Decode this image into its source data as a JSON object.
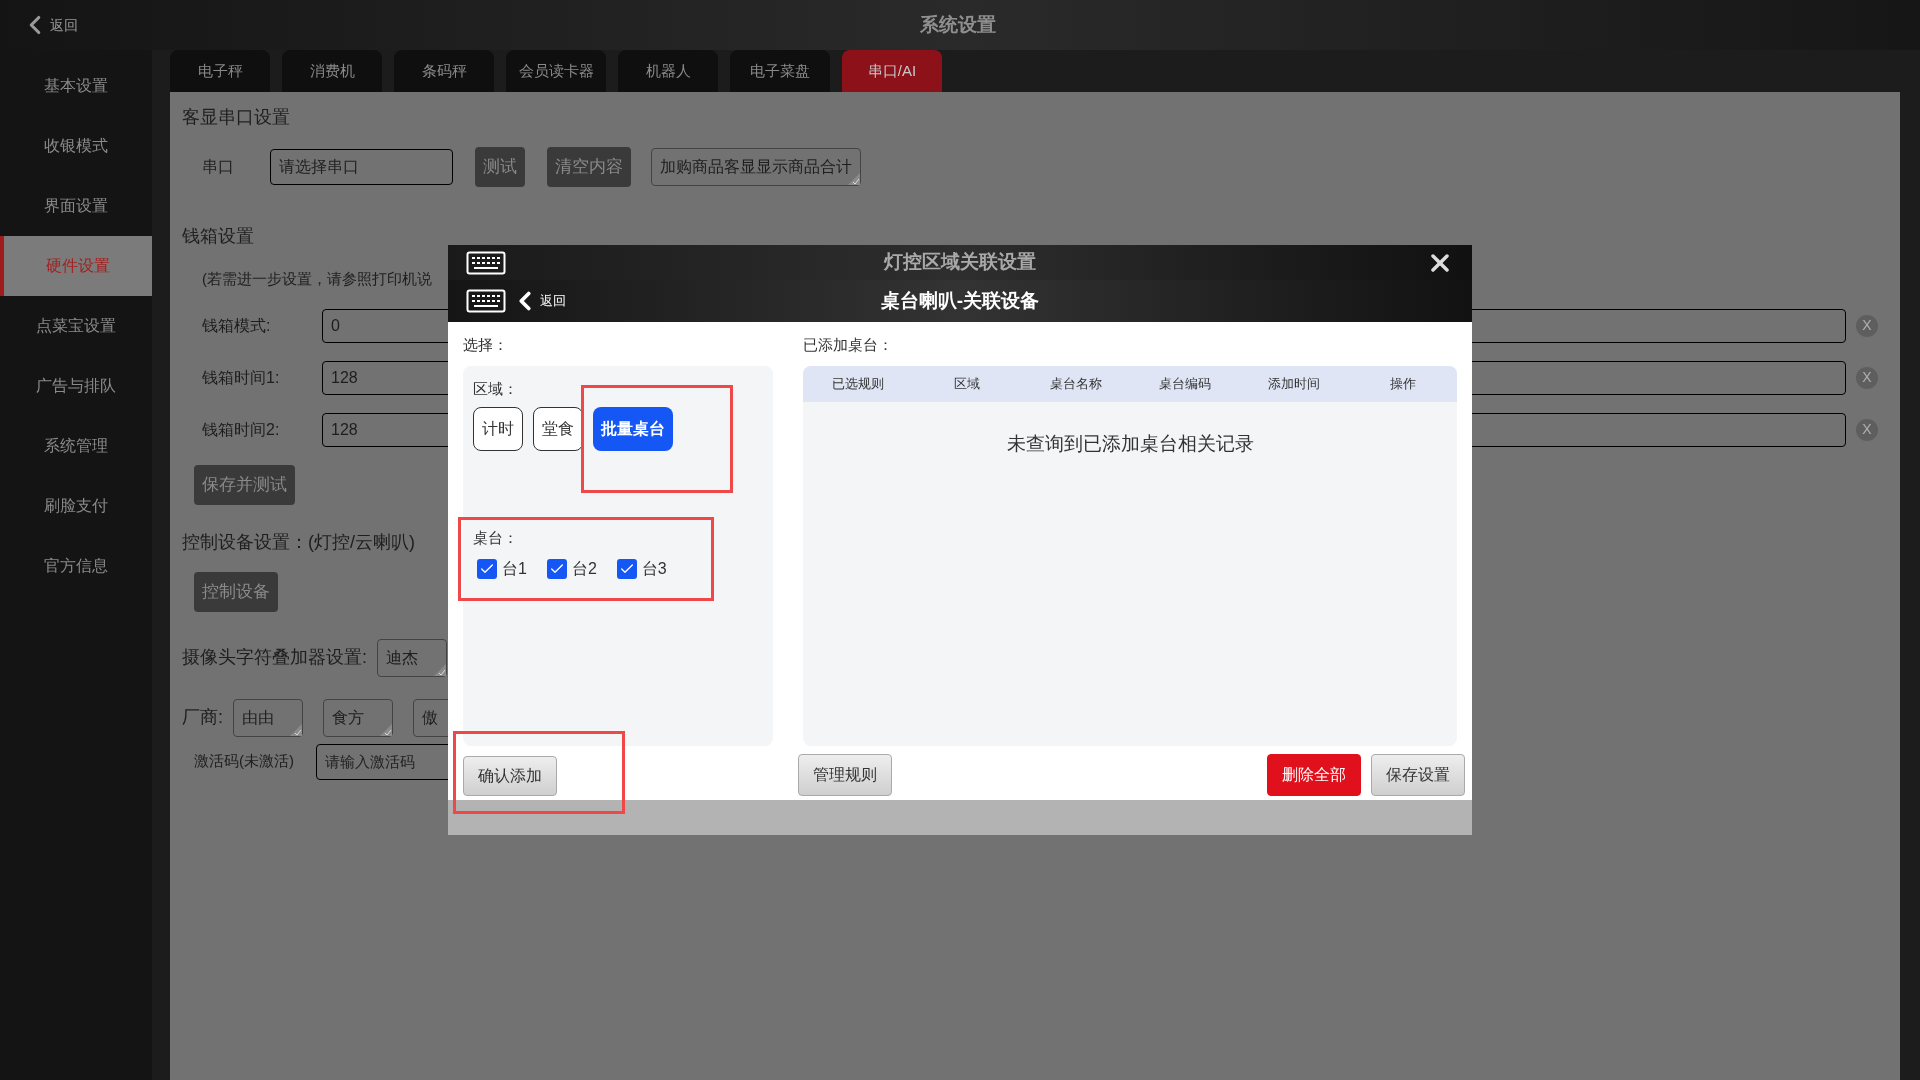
{
  "top_bar": {
    "back": "返回",
    "title": "系统设置"
  },
  "sidebar": {
    "items": [
      {
        "label": "基本设置",
        "selected": false
      },
      {
        "label": "收银模式",
        "selected": false
      },
      {
        "label": "界面设置",
        "selected": false
      },
      {
        "label": "硬件设置",
        "selected": true
      },
      {
        "label": "点菜宝设置",
        "selected": false
      },
      {
        "label": "广告与排队",
        "selected": false
      },
      {
        "label": "系统管理",
        "selected": false
      },
      {
        "label": "刷脸支付",
        "selected": false
      },
      {
        "label": "官方信息",
        "selected": false
      }
    ]
  },
  "tabs": [
    {
      "label": "电子秤",
      "selected": false
    },
    {
      "label": "消费机",
      "selected": false
    },
    {
      "label": "条码秤",
      "selected": false
    },
    {
      "label": "会员读卡器",
      "selected": false
    },
    {
      "label": "机器人",
      "selected": false
    },
    {
      "label": "电子菜盘",
      "selected": false
    },
    {
      "label": "串口/AI",
      "selected": true
    }
  ],
  "panel": {
    "display_section": {
      "title": "客显串口设置",
      "port_label": "串口",
      "port_placeholder": "请选择串口",
      "buttons": [
        "测试",
        "清空内容"
      ],
      "option": "加购商品客显显示商品合计"
    },
    "drawer": {
      "title": "钱箱设置",
      "note": "(若需进一步设置，请参照打印机说",
      "fields": [
        {
          "label": "钱箱模式:",
          "value": "0",
          "clear": "X"
        },
        {
          "label": "钱箱时间1:",
          "value": "128",
          "clear": "X"
        },
        {
          "label": "钱箱时间2:",
          "value": "128",
          "clear": "X"
        }
      ],
      "button": "保存并测试"
    },
    "control": {
      "title": "控制设备设置：(灯控/云喇叭)",
      "button": "控制设备"
    },
    "camera": {
      "label": "摄像头字符叠加器设置:",
      "option": "迪杰"
    },
    "vendor": {
      "label": "厂商:",
      "options": [
        "由由",
        "食方",
        "傲"
      ]
    },
    "activation": {
      "label": "激活码(未激活)",
      "placeholder": "请输入激活码"
    }
  },
  "modal": {
    "title": "灯控区域关联设置",
    "subtitle": "桌台喇叭-关联设备",
    "back": "返回",
    "select_label": "选择：",
    "area_label": "区域：",
    "areas": [
      {
        "label": "计时",
        "selected": false,
        "highlighted": false
      },
      {
        "label": "堂食",
        "selected": false,
        "highlighted": false
      },
      {
        "label": "批量桌台",
        "selected": true,
        "highlighted": true
      }
    ],
    "tables_label": "桌台：",
    "tables_highlighted": true,
    "tables": [
      {
        "label": "台1",
        "checked": true
      },
      {
        "label": "台2",
        "checked": true
      },
      {
        "label": "台3",
        "checked": true
      }
    ],
    "confirm": {
      "label": "确认添加",
      "highlighted": true
    },
    "added_label": "已添加桌台：",
    "columns": [
      "已选规则",
      "区域",
      "桌台名称",
      "桌台编码",
      "添加时间",
      "操作"
    ],
    "empty": "未查询到已添加桌台相关记录",
    "buttons": [
      {
        "label": "管理规则",
        "kind": "plain"
      },
      {
        "label": "删除全部",
        "kind": "danger"
      },
      {
        "label": "保存设置",
        "kind": "plain"
      }
    ]
  }
}
